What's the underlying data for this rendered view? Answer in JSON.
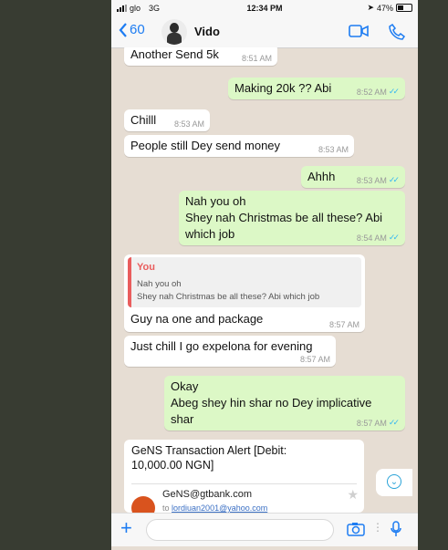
{
  "status": {
    "carrier": "glo",
    "network": "3G",
    "time": "12:34 PM",
    "battery": "47%"
  },
  "header": {
    "back_count": "60",
    "contact_name": "Vido"
  },
  "messages": [
    {
      "dir": "in",
      "text": "Another Send 5k",
      "time": "8:51 AM"
    },
    {
      "dir": "out",
      "text": "Making 20k ?? Abi",
      "time": "8:52 AM"
    },
    {
      "dir": "in",
      "text": "Chilll",
      "time": "8:53 AM"
    },
    {
      "dir": "in",
      "text": "People still Dey send money",
      "time": "8:53 AM"
    },
    {
      "dir": "out",
      "text": "Ahhh",
      "time": "8:53 AM"
    },
    {
      "dir": "out",
      "lines": [
        "Nah you oh",
        "Shey nah Christmas be all these? Abi",
        "which job"
      ],
      "time": "8:54 AM"
    },
    {
      "dir": "in",
      "quote": {
        "author": "You",
        "line1": "Nah you oh",
        "line2": "Shey nah Christmas be all these? Abi which job"
      },
      "text": "Guy na one and package",
      "time": "8:57 AM"
    },
    {
      "dir": "in",
      "text": "Just chill I go expelona for evening",
      "time": "8:57 AM"
    },
    {
      "dir": "out",
      "lines": [
        "Okay",
        "Abeg shey hin shar no Dey implicative",
        "shar"
      ],
      "time": "8:57 AM"
    }
  ],
  "email_card": {
    "title_line1": "GeNS Transaction Alert [Debit:",
    "title_line2": "10,000.00 NGN]",
    "sender": "GeNS@gtbank.com",
    "to_label": "to",
    "to_address": "lordiuan2001@yahoo.com"
  },
  "icons": {
    "back": "chevron-left-icon",
    "video": "video-call-icon",
    "phone": "phone-call-icon",
    "plus": "plus-icon",
    "camera": "camera-icon",
    "mic": "microphone-icon",
    "scroll": "scroll-down-icon",
    "star": "star-icon"
  },
  "colors": {
    "accent": "#1d7cf2",
    "outgoing": "#dcf8c6",
    "incoming": "#ffffff",
    "quote_accent": "#e95d5d",
    "read_ticks": "#34b7f1"
  }
}
